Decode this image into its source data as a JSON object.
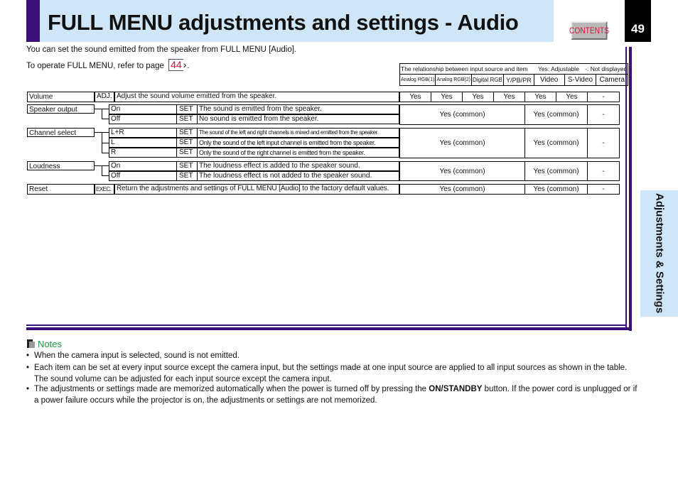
{
  "header": {
    "title": "FULL MENU adjustments and settings - Audio",
    "contents_label": "CONTENTS",
    "page_number": "49"
  },
  "side_tab": {
    "label": "Adjustments & Settings"
  },
  "intro": {
    "line1": "You can set the sound emitted from the speaker from FULL MENU [Audio].",
    "line2_prefix": "To operate FULL MENU, refer to page",
    "page_ref": "44",
    "line2_suffix": "."
  },
  "legend": {
    "title": "The relationship between input source and item",
    "key_yes": "Yes: Adjustable",
    "key_dash": "-: Not displayed",
    "columns": [
      "Analog RGB(1)",
      "Analog RGB(2)",
      "Digital RGB",
      "Y/PB/PR",
      "Video",
      "S-Video",
      "Camera"
    ]
  },
  "items": [
    {
      "name": "Volume",
      "type": "ADJ.",
      "description": "Adjust the sound volume emitted from the speaker.",
      "values": [
        "Yes",
        "Yes",
        "Yes",
        "Yes",
        "Yes",
        "Yes",
        "-"
      ]
    },
    {
      "name": "Speaker output",
      "options": [
        {
          "option": "On",
          "type": "SET",
          "description": "The sound is emitted from the speaker."
        },
        {
          "option": "Off",
          "type": "SET",
          "description": "No sound is emitted from the speaker."
        }
      ],
      "values": [
        "Yes (common)",
        "Yes (common)",
        "-"
      ]
    },
    {
      "name": "Channel select",
      "options": [
        {
          "option": "L+R",
          "type": "SET",
          "description": "The sound of the left and right channels is mixed and emitted from the speaker."
        },
        {
          "option": "L",
          "type": "SET",
          "description": "Only the sound of the left input channel is emitted from the speaker."
        },
        {
          "option": "R",
          "type": "SET",
          "description": "Only the sound of the right channel is emitted from the speaker."
        }
      ],
      "values": [
        "Yes (common)",
        "Yes (common)",
        "-"
      ]
    },
    {
      "name": "Loudness",
      "options": [
        {
          "option": "On",
          "type": "SET",
          "description": "The loudness effect is added to the speaker sound."
        },
        {
          "option": "Off",
          "type": "SET",
          "description": "The loudness effect is not added to the speaker sound."
        }
      ],
      "values": [
        "Yes (common)",
        "Yes (common)",
        "-"
      ]
    },
    {
      "name": "Reset",
      "type": "EXEC.",
      "description": "Return the adjustments and settings of FULL MENU [Audio] to the factory default values.",
      "values": [
        "Yes (common)",
        "Yes (common)",
        "-"
      ]
    }
  ],
  "notes": {
    "title": "Notes",
    "items": [
      {
        "text": "When the camera input is selected, sound is not emitted."
      },
      {
        "text": "Each item can be set at every input source except the camera input, but the settings made at one input source are applied to all input sources as shown in the table. The sound volume can be adjusted for each input source except the camera input."
      },
      {
        "pre": "The adjustments or settings made are memorized automatically when the power is turned off by pressing the ",
        "bold": "ON/STANDBY",
        "post": " button. If the power cord is unplugged or if a power failure occurs while the projector is on, the adjustments or settings are not memorized."
      }
    ]
  },
  "colors": {
    "accent": "#3a0f7a",
    "header_bg": "#cfe6f8",
    "link_red": "#e0103a",
    "notes_green": "#139a3a"
  }
}
